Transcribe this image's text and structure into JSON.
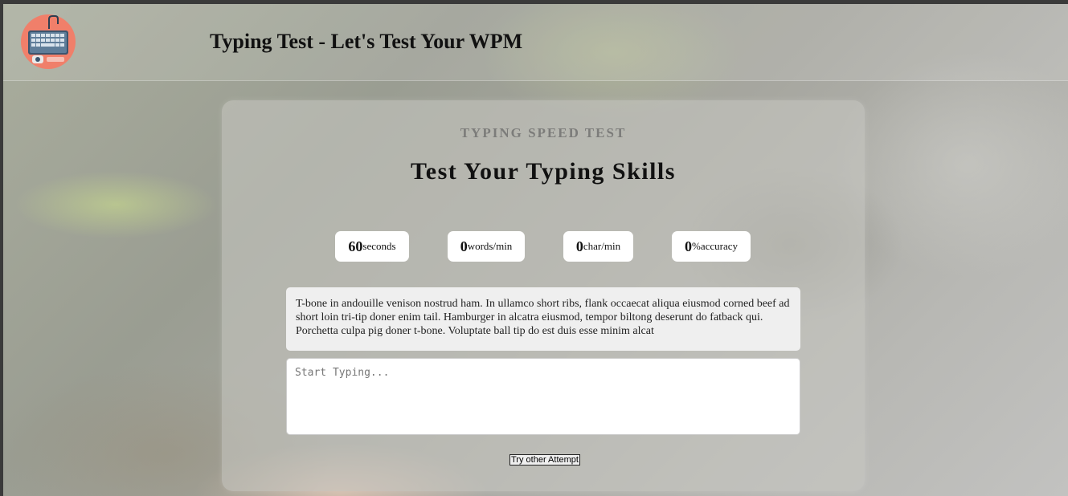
{
  "header": {
    "title": "Typing Test - Let's Test Your WPM",
    "logo_icon": "keyboard-logo-icon"
  },
  "card": {
    "eyebrow": "TYPING SPEED TEST",
    "heading": "Test Your Typing Skills",
    "stats": [
      {
        "value": "60",
        "unit": "seconds"
      },
      {
        "value": "0",
        "unit": "words/min"
      },
      {
        "value": "0",
        "unit": "char/min"
      },
      {
        "value": "0",
        "unit": "%accuracy"
      }
    ],
    "quote": "T-bone in andouille venison nostrud ham. In ullamco short ribs, flank occaecat aliqua eiusmod corned beef ad short loin tri-tip doner enim tail. Hamburger in alcatra eiusmod, tempor biltong deserunt do fatback qui. Porchetta culpa pig doner t-bone. Voluptate ball tip do est duis esse minim alcat",
    "input": {
      "placeholder": "Start Typing...",
      "value": ""
    },
    "retry_label": "Try other Attempt"
  },
  "colors": {
    "logo_bg": "#f07f6a",
    "stat_bg": "#ffffff",
    "quote_bg": "#efefef"
  }
}
